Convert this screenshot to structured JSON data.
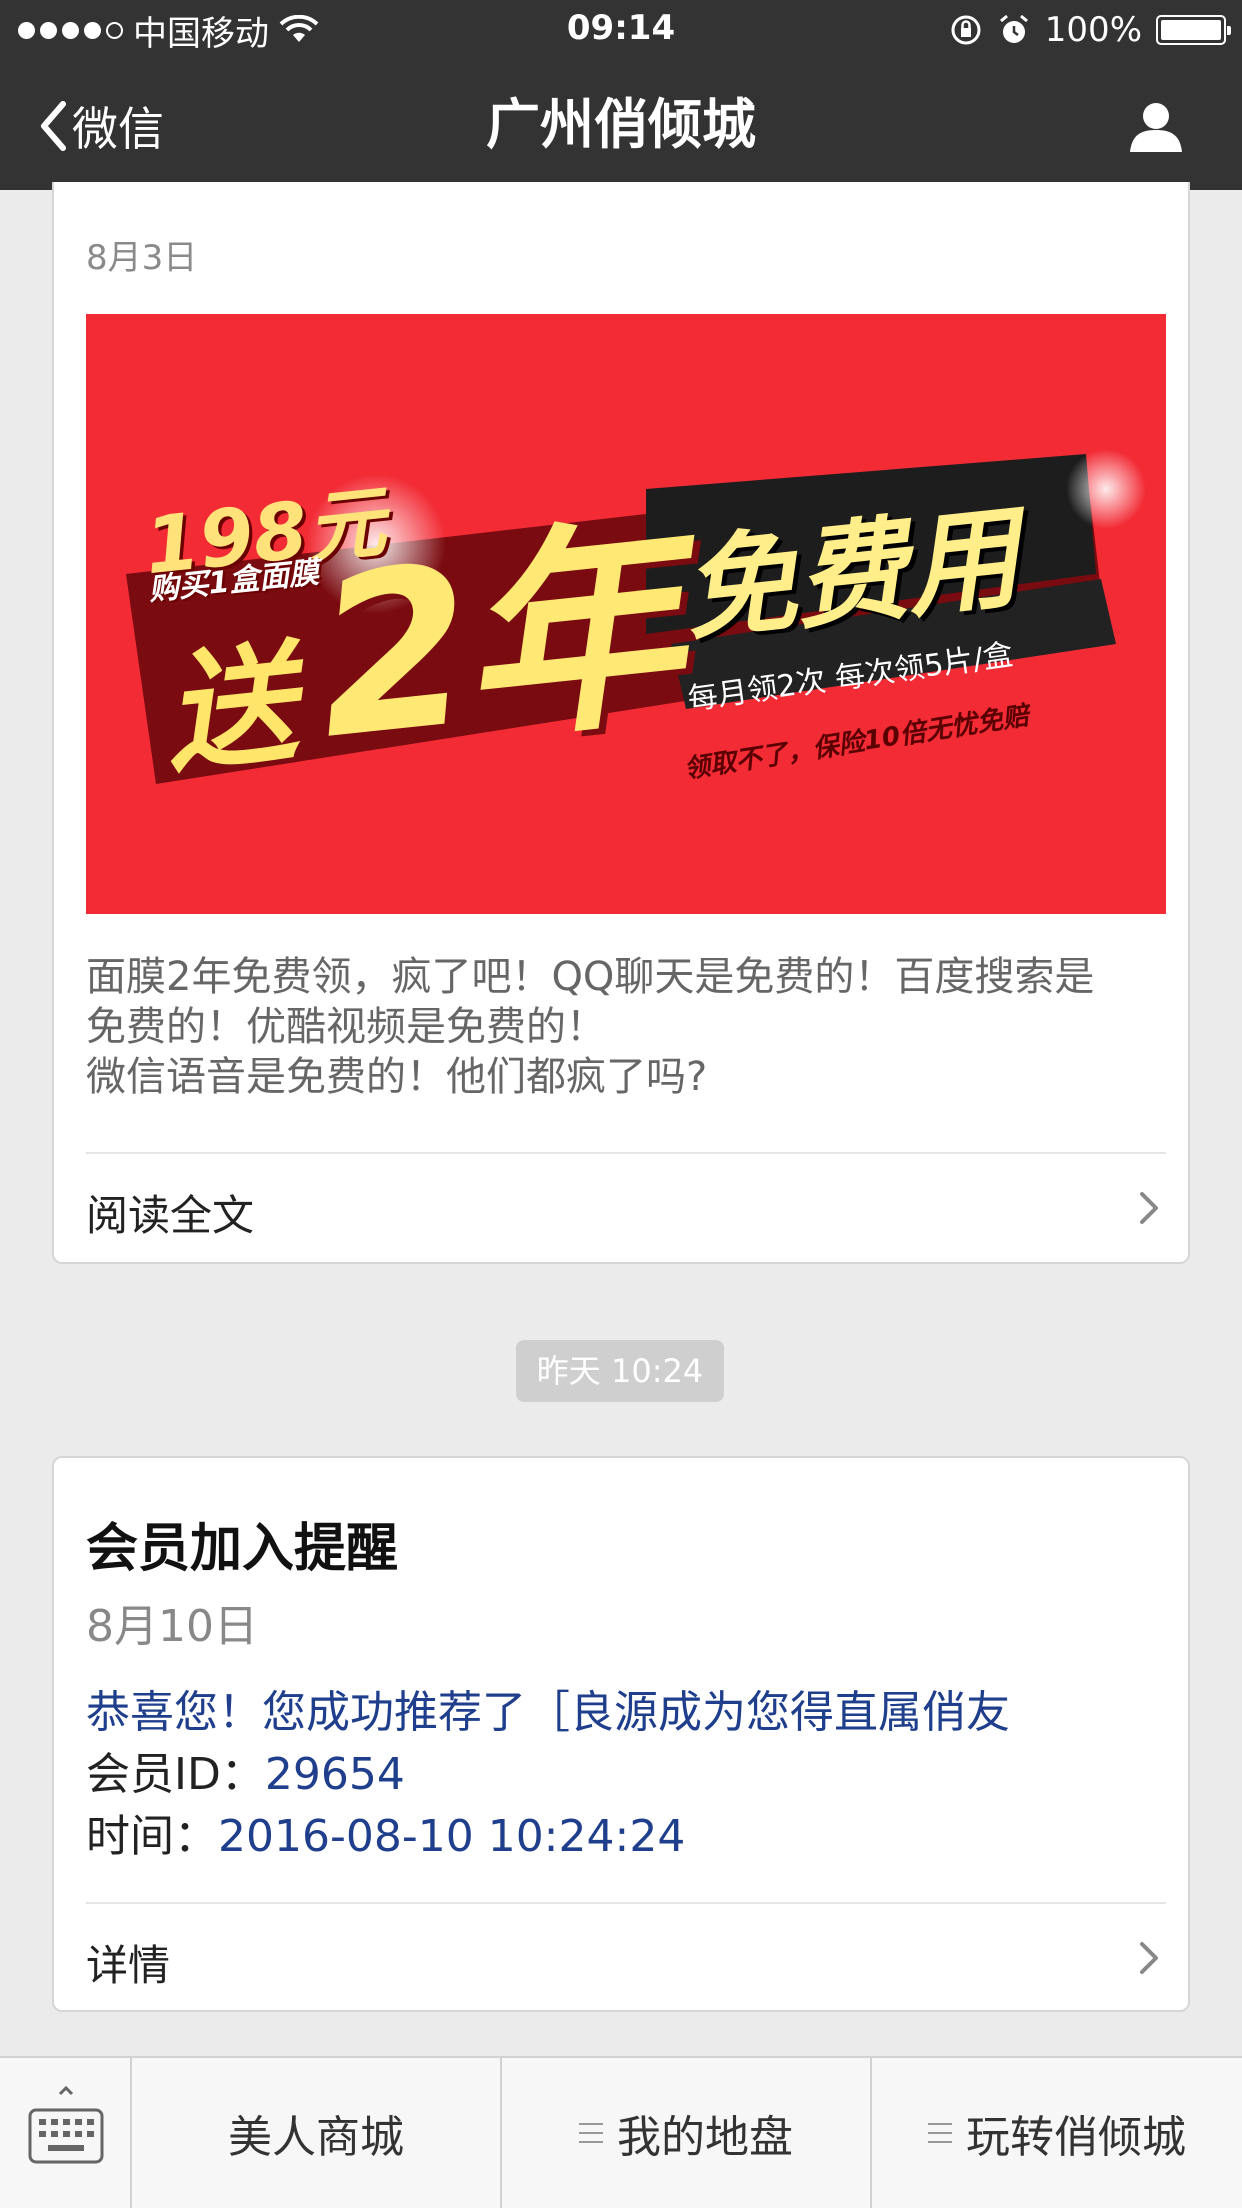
{
  "status_bar": {
    "carrier": "中国移动",
    "time": "09:14",
    "battery": "100%"
  },
  "nav": {
    "back_label": "微信",
    "title": "广州俏倾城"
  },
  "card1": {
    "date": "8月3日",
    "banner": {
      "price": "198元",
      "buy_text": "购买1盒面膜",
      "gift_char": "送",
      "big_text": "2年",
      "headline": "免费用",
      "sub1": "每月领2次  每次领5片/盒",
      "sub2": "领取不了，保险10倍无忧免赔"
    },
    "desc": [
      "面膜2年免费领，疯了吧！QQ聊天是免费的！百度搜索是",
      "免费的！优酷视频是免费的！",
      "微信语音是免费的！他们都疯了吗?"
    ],
    "read_more": "阅读全文"
  },
  "timestamp": "昨天 10:24",
  "card2": {
    "title": "会员加入提醒",
    "date": "8月10日",
    "message": "恭喜您！您成功推荐了［良源成为您得直属俏友",
    "member_label": "会员ID：",
    "member_id": "29654",
    "time_label": "时间：",
    "time_value": "2016-08-10 10:24:24",
    "details": "详情"
  },
  "bottom_menu": {
    "items": [
      "美人商城",
      "我的地盘",
      "玩转俏倾城"
    ]
  },
  "colors": {
    "bar_bg": "#333333",
    "page_bg": "#ebebeb",
    "banner_red": "#f22b35",
    "link_blue": "#1f3e8c"
  }
}
